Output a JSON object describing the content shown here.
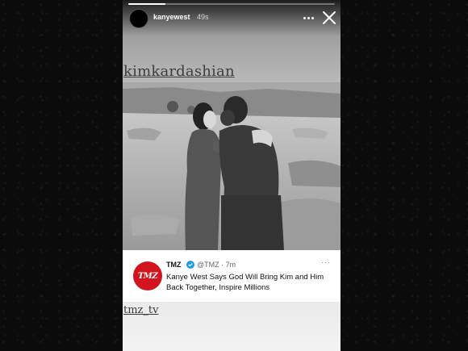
{
  "story": {
    "username": "kanyewest",
    "timestamp": "49s",
    "progress_fraction": 0.18,
    "more_icon": "more-horizontal-icon",
    "close_icon": "close-icon"
  },
  "mentions": {
    "top": "kimkardashian",
    "bottom": "tmz_tv"
  },
  "tweet": {
    "logo_text": "TMZ",
    "name": "TMZ",
    "handle_time": "@TMZ · 7m",
    "more": "···",
    "text": "Kanye West Says God Will Bring Kim and Him Back Together, Inspire Millions",
    "colors": {
      "logo": "#d1141d",
      "verified": "#1d9bf0"
    }
  }
}
